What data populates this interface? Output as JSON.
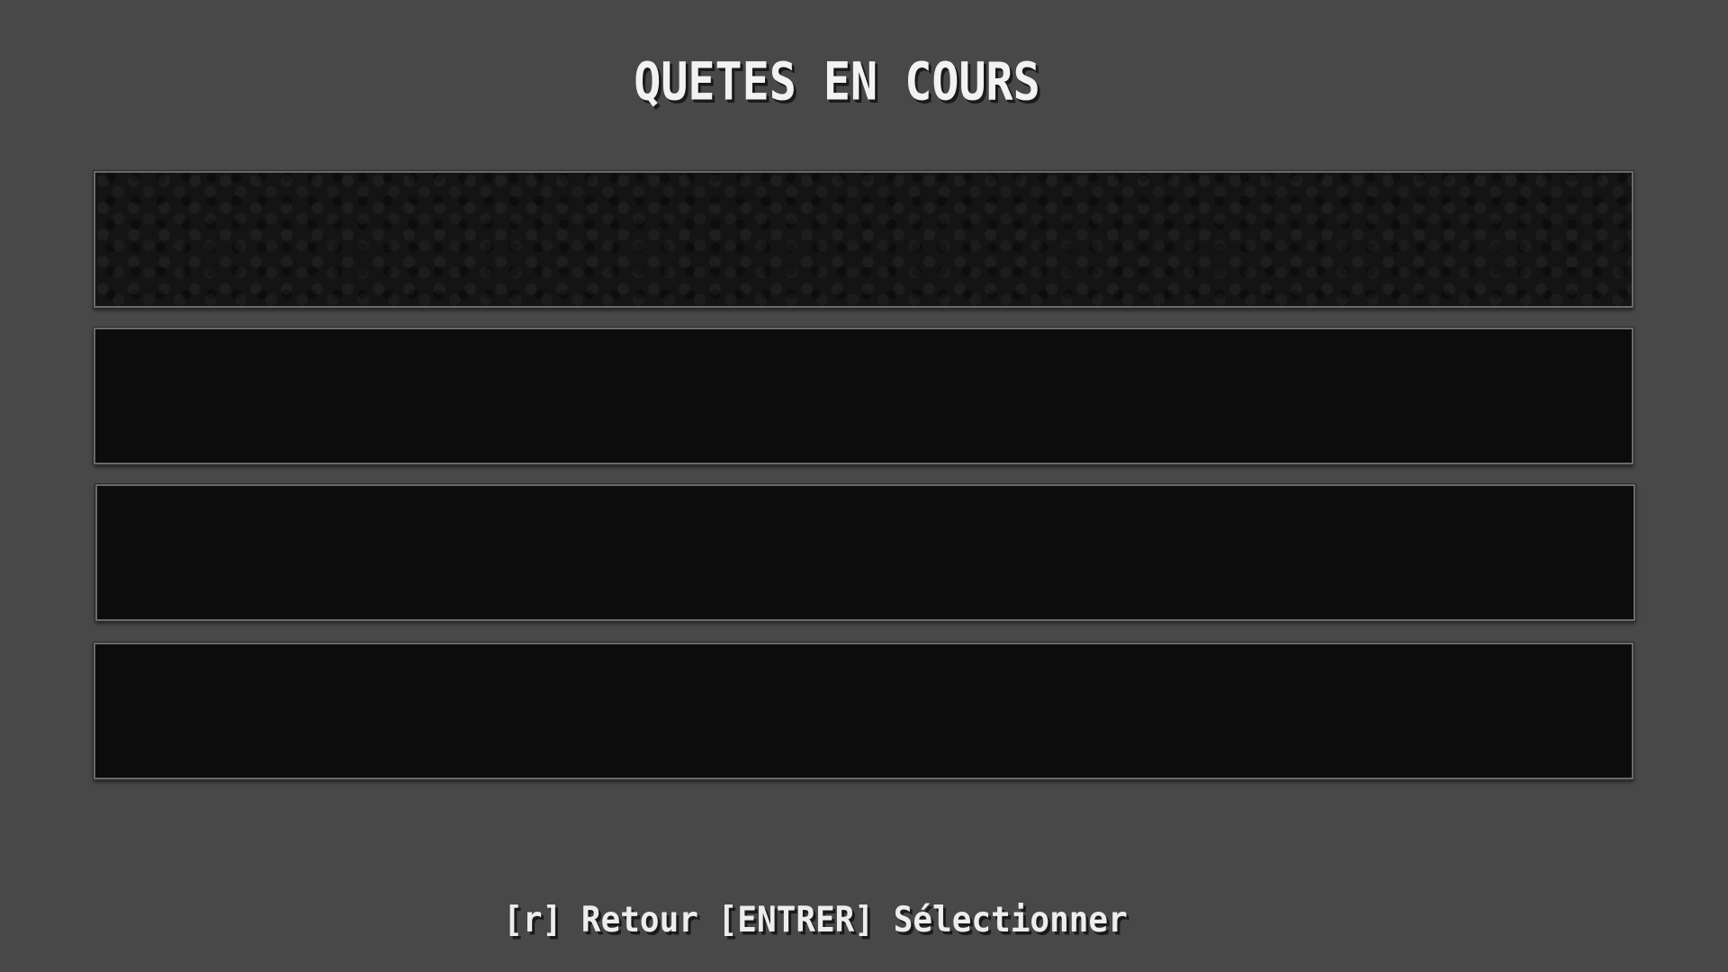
{
  "screen": {
    "title": "QUETES EN COURS",
    "hint": "[r] Retour [ENTRER] Sélectionner"
  },
  "quests": [
    {
      "label": "",
      "selected": true
    },
    {
      "label": "",
      "selected": false
    },
    {
      "label": "",
      "selected": false
    },
    {
      "label": "",
      "selected": false
    }
  ],
  "colors": {
    "background": "#484848",
    "slot": "#0c0c0c",
    "slot_border": "#6a6a6a",
    "text": "#f2f2f2"
  }
}
